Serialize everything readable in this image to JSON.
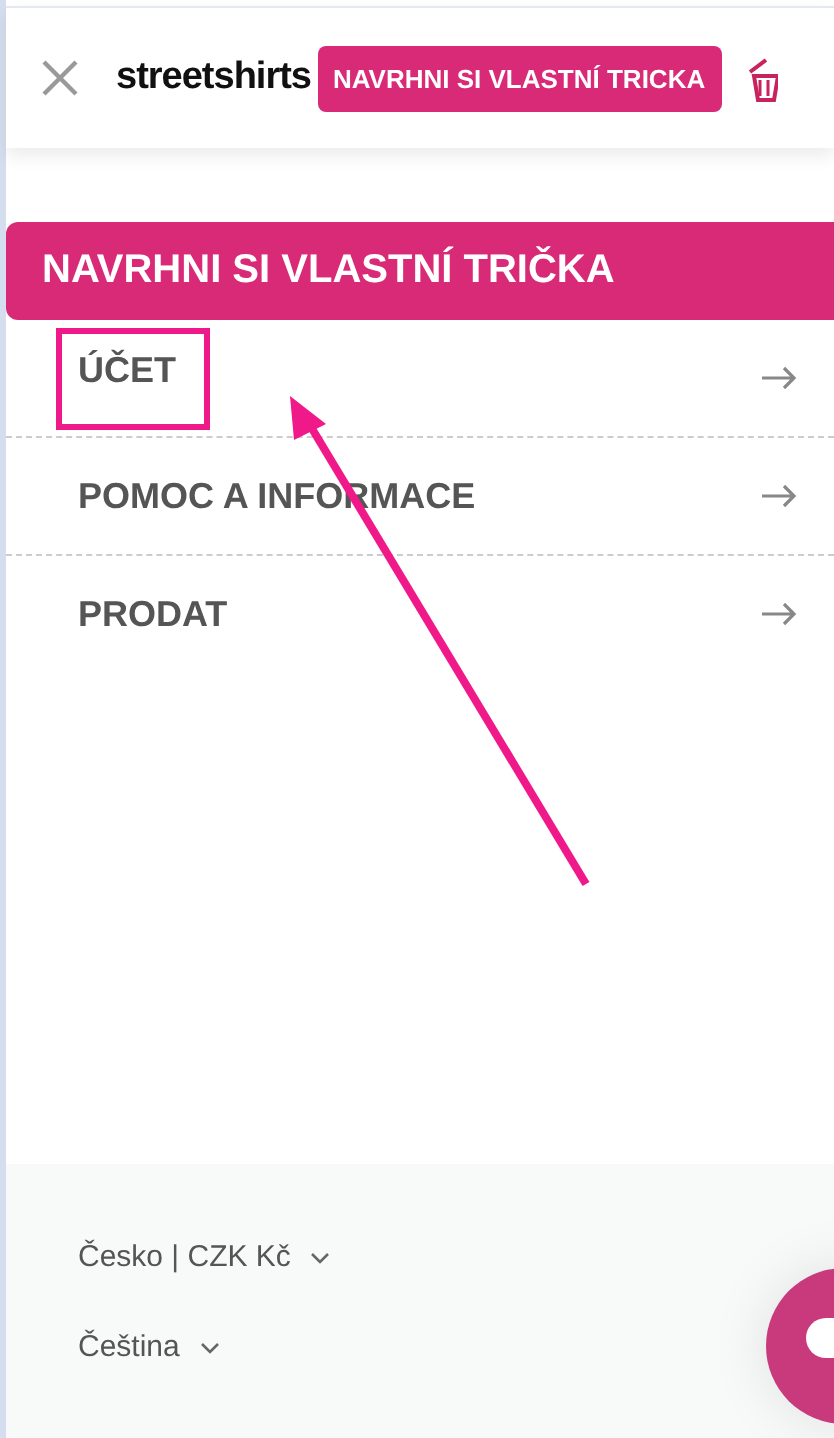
{
  "header": {
    "logo": "streetshirts",
    "cta_button": "NAVRHNI SI VLASTNÍ TRICKA"
  },
  "menu": {
    "banner": "NAVRHNI SI VLASTNÍ TRIČKA",
    "items": [
      {
        "label": "ÚČET",
        "highlighted": true
      },
      {
        "label": "POMOC A INFORMACE",
        "highlighted": false
      },
      {
        "label": "PRODAT",
        "highlighted": false
      }
    ]
  },
  "footer": {
    "selectors": [
      "Česko | CZK Kč",
      "Čeština"
    ]
  }
}
